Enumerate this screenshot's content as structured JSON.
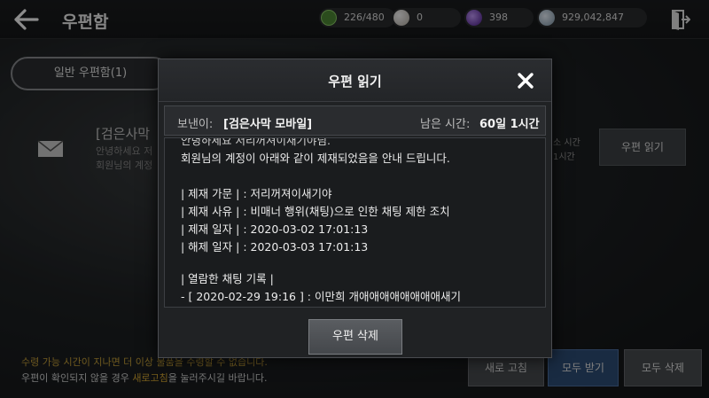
{
  "header": {
    "title": "우편함",
    "resources": [
      {
        "icon": "green-token-icon",
        "value": "226/480",
        "color": "#6fb34a"
      },
      {
        "icon": "pearl-icon",
        "value": "0",
        "color": "#d9d2c7"
      },
      {
        "icon": "purple-orb-icon",
        "value": "398",
        "color": "#7a3cc9"
      },
      {
        "icon": "silver-coin-icon",
        "value": "929,042,847",
        "color": "#9fb6c8"
      }
    ]
  },
  "tabs": {
    "general": "일반 우편함(1)"
  },
  "mail_item": {
    "title": "[검은사막",
    "preview1": "안녕하세요 저",
    "preview2": "회원님의 계정",
    "time1": "소 시간",
    "time2": "1시간",
    "read_button": "우편 읽기"
  },
  "footer": {
    "note1": "수령 가능 시간이 지나면 더 이상 물품을 수령할 수 없습니다.",
    "note2_prefix": "우편이 확인되지 않을 경우 ",
    "note2_highlight": "새로고침",
    "note2_suffix": "을 눌러주시길 바랍니다.",
    "refresh_button": "새로 고침",
    "receive_all_button": "모두 받기",
    "delete_all_button": "모두 삭제"
  },
  "modal": {
    "title": "우편 읽기",
    "sender_label": "보낸이:",
    "sender": "[검은사막 모바일]",
    "remaining_label": "남은 시간:",
    "remaining": "60일 1시간",
    "body_lines": [
      "안녕하세요 저리꺼져이새기야님.",
      "회원님의 계정이 아래와 같이 제재되었음을 안내 드립니다.",
      "",
      "| 제재 가문 |   : 저리꺼져이새기야",
      "| 제재 사유 |   : 비매너 행위(채팅)으로 인한 채팅 제한 조치",
      "| 제재 일자 |   : 2020-03-02 17:01:13",
      "| 해제 일자 |   : 2020-03-03 17:01:13",
      "",
      "| 열람한 채팅 기록 |",
      "- [ 2020-02-29 19:16 ] : 이만희 개애애애애애애애애새기"
    ],
    "delete_button": "우편 삭제"
  }
}
